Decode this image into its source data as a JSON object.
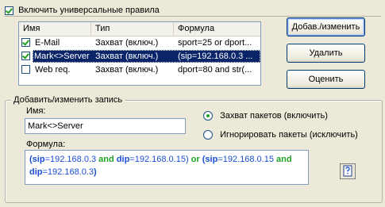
{
  "universal_rules": {
    "label": "Включить универсальные правила",
    "checked": true
  },
  "list": {
    "columns": [
      "Имя",
      "Тип",
      "Формула"
    ],
    "rows": [
      {
        "checked": true,
        "name": "E-Mail",
        "type": "Захват (включ.)",
        "formula": "sport=25 or dport...",
        "selected": false
      },
      {
        "checked": true,
        "name": "Mark<>Server",
        "type": "Захват (включ.)",
        "formula": "(sip=192.168.0.3 ...",
        "selected": true
      },
      {
        "checked": false,
        "name": "Web req.",
        "type": "Захват (включ.)",
        "formula": "dport=80 and str(...",
        "selected": false
      }
    ]
  },
  "buttons": {
    "add_edit": "Добав./изменить",
    "delete": "Удалить",
    "rate": "Оценить"
  },
  "edit_group": {
    "legend": "Добавить/изменить запись",
    "name_label": "Имя:",
    "name_value": "Mark<>Server",
    "formula_label": "Формула:",
    "radio_capture": "Захват пакетов (включить)",
    "radio_ignore": "Игнорировать пакеты (исключить)",
    "capture_selected": true
  },
  "formula": {
    "t1": "(",
    "t2": "sip",
    "t3": "=192.168.0.3 ",
    "t4": "and",
    "t5": " ",
    "t6": "dip",
    "t7": "=192.168.0.15) ",
    "t8": "or",
    "t9": " (",
    "t10": "sip",
    "t11": "=192.168.0.15 ",
    "t12": "and",
    "t13": "dip",
    "t14": "=192.168.0.3",
    "t15": ")"
  },
  "colors": {
    "accent": "#0a246a",
    "keyword": "#21a121",
    "field": "#1a4fd6"
  },
  "icons": {
    "formula_help": "formula-help-icon"
  }
}
